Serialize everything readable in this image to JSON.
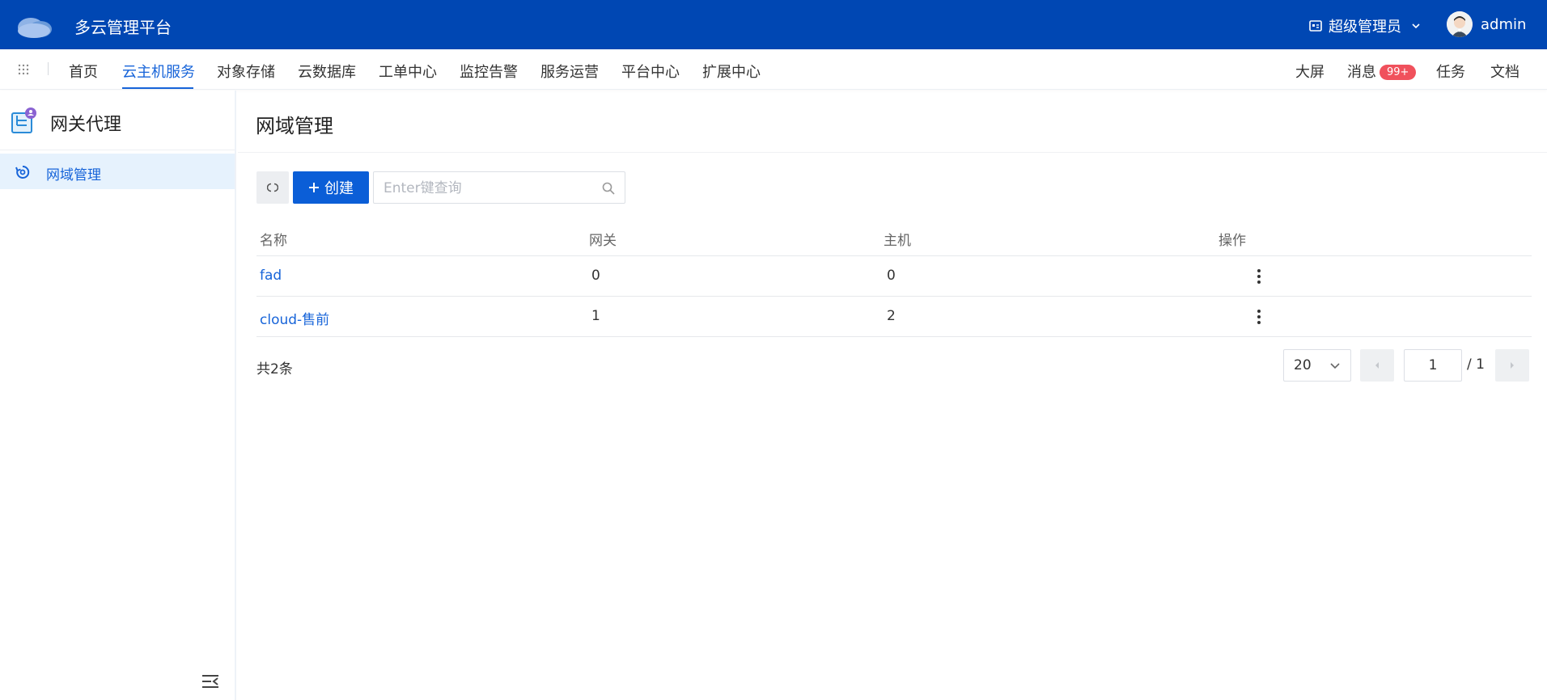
{
  "header": {
    "brand": "多云管理平台",
    "role": "超级管理员",
    "user": "admin"
  },
  "nav": {
    "items": [
      "首页",
      "云主机服务",
      "对象存储",
      "云数据库",
      "工单中心",
      "监控告警",
      "服务运营",
      "平台中心",
      "扩展中心"
    ],
    "active": "云主机服务",
    "right": {
      "bigscreen": "大屏",
      "messages": "消息",
      "messages_badge": "99+",
      "tasks": "任务",
      "docs": "文档"
    }
  },
  "sidebar": {
    "title": "网关代理",
    "items": [
      {
        "label": "网域管理",
        "active": true
      }
    ]
  },
  "main": {
    "title": "网域管理",
    "create_label": "创建",
    "search_placeholder": "Enter键查询",
    "table": {
      "columns": [
        "名称",
        "网关",
        "主机",
        "操作"
      ],
      "rows": [
        {
          "name": "fad",
          "gateway": "0",
          "host": "0"
        },
        {
          "name": "cloud-售前",
          "gateway": "1",
          "host": "2"
        }
      ]
    },
    "footer": {
      "total": "共2条",
      "page_size": "20",
      "current_page": "1",
      "total_pages": "/ 1"
    }
  },
  "colors": {
    "header_bg": "#0047b3",
    "accent": "#1764d9",
    "primary_button": "#0b5ed7",
    "badge": "#f0515c",
    "sidebar_active_bg": "#e6f2fd"
  }
}
